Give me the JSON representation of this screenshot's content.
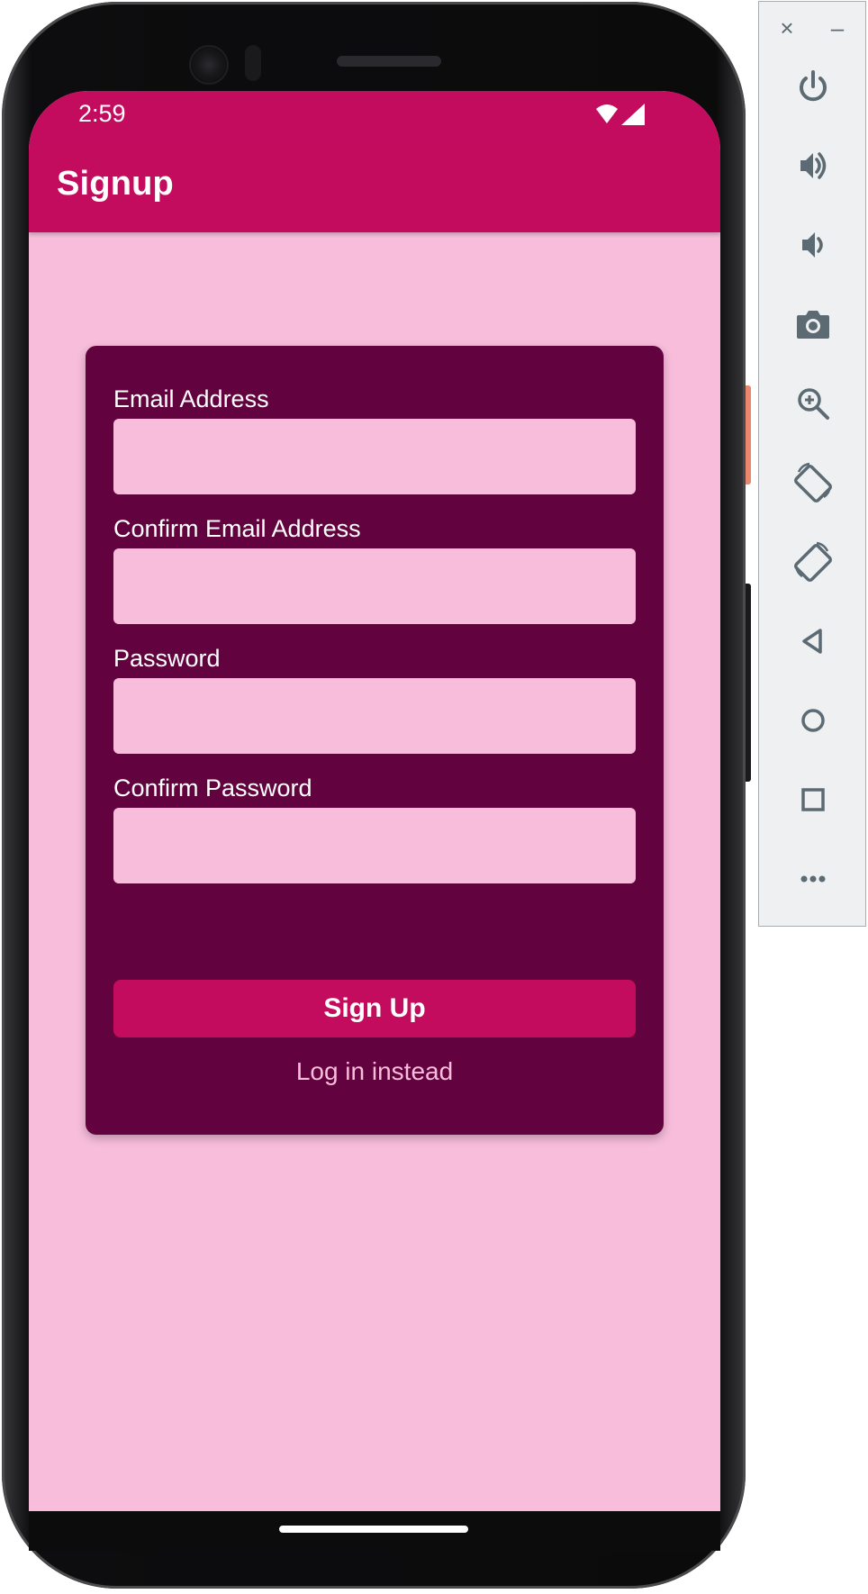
{
  "status_bar": {
    "time": "2:59",
    "icons": [
      "wifi-icon",
      "cellular-signal-icon"
    ]
  },
  "app_bar": {
    "title": "Signup"
  },
  "form": {
    "email_label": "Email Address",
    "email_value": "",
    "confirm_email_label": "Confirm Email Address",
    "confirm_email_value": "",
    "password_label": "Password",
    "password_value": "",
    "confirm_password_label": "Confirm Password",
    "confirm_password_value": "",
    "submit_label": "Sign Up",
    "alt_link_label": "Log in instead"
  },
  "emulator_panel": {
    "top_controls": [
      "close-icon",
      "minimize-icon"
    ],
    "controls": [
      "power-icon",
      "volume-up-icon",
      "volume-down-icon",
      "camera-icon",
      "zoom-in-icon",
      "rotate-left-icon",
      "rotate-right-icon",
      "back-icon",
      "home-icon",
      "overview-icon",
      "more-icon"
    ]
  },
  "colors": {
    "primary": "#c40c5f",
    "background": "#f7bddb",
    "card": "#62023e",
    "on_primary": "#ffffff",
    "emulator_icon": "#5c6b73"
  }
}
